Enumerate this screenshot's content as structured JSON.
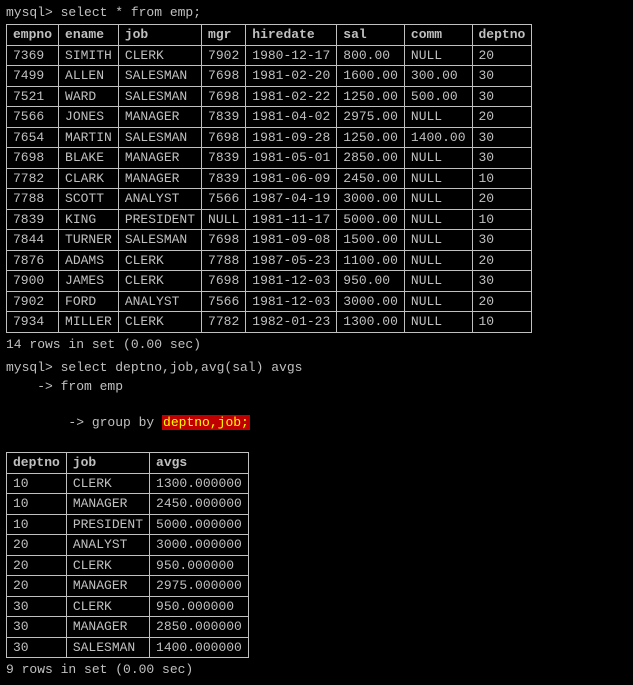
{
  "terminal": {
    "prompt1": "mysql> select * from emp;",
    "table1": {
      "headers": [
        "empno",
        "ename",
        "job",
        "mgr",
        "hiredate",
        "sal",
        "comm",
        "deptno"
      ],
      "rows": [
        [
          "7369",
          "SIMITH",
          "CLERK",
          "7902",
          "1980-12-17",
          "800.00",
          "NULL",
          "20"
        ],
        [
          "7499",
          "ALLEN",
          "SALESMAN",
          "7698",
          "1981-02-20",
          "1600.00",
          "300.00",
          "30"
        ],
        [
          "7521",
          "WARD",
          "SALESMAN",
          "7698",
          "1981-02-22",
          "1250.00",
          "500.00",
          "30"
        ],
        [
          "7566",
          "JONES",
          "MANAGER",
          "7839",
          "1981-04-02",
          "2975.00",
          "NULL",
          "20"
        ],
        [
          "7654",
          "MARTIN",
          "SALESMAN",
          "7698",
          "1981-09-28",
          "1250.00",
          "1400.00",
          "30"
        ],
        [
          "7698",
          "BLAKE",
          "MANAGER",
          "7839",
          "1981-05-01",
          "2850.00",
          "NULL",
          "30"
        ],
        [
          "7782",
          "CLARK",
          "MANAGER",
          "7839",
          "1981-06-09",
          "2450.00",
          "NULL",
          "10"
        ],
        [
          "7788",
          "SCOTT",
          "ANALYST",
          "7566",
          "1987-04-19",
          "3000.00",
          "NULL",
          "20"
        ],
        [
          "7839",
          "KING",
          "PRESIDENT",
          "NULL",
          "1981-11-17",
          "5000.00",
          "NULL",
          "10"
        ],
        [
          "7844",
          "TURNER",
          "SALESMAN",
          "7698",
          "1981-09-08",
          "1500.00",
          "NULL",
          "30"
        ],
        [
          "7876",
          "ADAMS",
          "CLERK",
          "7788",
          "1987-05-23",
          "1100.00",
          "NULL",
          "20"
        ],
        [
          "7900",
          "JAMES",
          "CLERK",
          "7698",
          "1981-12-03",
          "950.00",
          "NULL",
          "30"
        ],
        [
          "7902",
          "FORD",
          "ANALYST",
          "7566",
          "1981-12-03",
          "3000.00",
          "NULL",
          "20"
        ],
        [
          "7934",
          "MILLER",
          "CLERK",
          "7782",
          "1982-01-23",
          "1300.00",
          "NULL",
          "10"
        ]
      ]
    },
    "rows_line1": "14 rows in set (0.00 sec)",
    "prompt2a": "mysql> select deptno,job,avg(sal) avgs",
    "prompt2b": "    -> from emp",
    "prompt2c": "    -> group by ",
    "highlight_text": "deptno,job;",
    "table2": {
      "headers": [
        "deptno",
        "job",
        "avgs"
      ],
      "rows": [
        [
          "10",
          "CLERK",
          "1300.000000"
        ],
        [
          "10",
          "MANAGER",
          "2450.000000"
        ],
        [
          "10",
          "PRESIDENT",
          "5000.000000"
        ],
        [
          "20",
          "ANALYST",
          "3000.000000"
        ],
        [
          "20",
          "CLERK",
          "950.000000"
        ],
        [
          "20",
          "MANAGER",
          "2975.000000"
        ],
        [
          "30",
          "CLERK",
          "950.000000"
        ],
        [
          "30",
          "MANAGER",
          "2850.000000"
        ],
        [
          "30",
          "SALESMAN",
          "1400.000000"
        ]
      ]
    },
    "rows_line2": "9 rows in set (0.00 sec)"
  }
}
